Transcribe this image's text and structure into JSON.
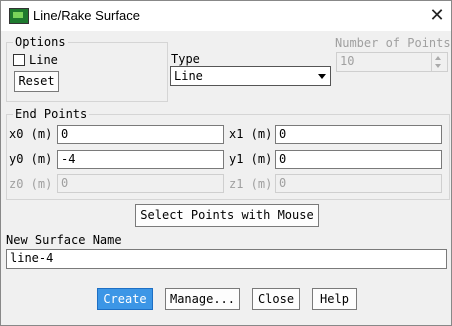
{
  "window": {
    "title": "Line/Rake Surface",
    "close_glyph": "✕"
  },
  "options": {
    "legend": "Options",
    "line_checkbox_label": "Line",
    "line_checked": false,
    "reset_label": "Reset"
  },
  "type": {
    "label": "Type",
    "selected": "Line"
  },
  "number_of_points": {
    "label": "Number of Points",
    "value": "10"
  },
  "end_points": {
    "legend": "End Points",
    "x0": {
      "label": "x0  (m)",
      "value": "0"
    },
    "x1": {
      "label": "x1  (m)",
      "value": "0"
    },
    "y0": {
      "label": "y0  (m)",
      "value": "-4"
    },
    "y1": {
      "label": "y1  (m)",
      "value": "0"
    },
    "z0": {
      "label": "z0  (m)",
      "value": "0"
    },
    "z1": {
      "label": "z1  (m)",
      "value": "0"
    }
  },
  "select_points_label": "Select Points with Mouse",
  "new_surface": {
    "label": "New Surface Name",
    "value": "line-4"
  },
  "buttons": {
    "create": "Create",
    "manage": "Manage...",
    "close": "Close",
    "help": "Help"
  },
  "colors": {
    "primary_button": "#3c96e6",
    "icon_green": "#1e7a2e"
  }
}
